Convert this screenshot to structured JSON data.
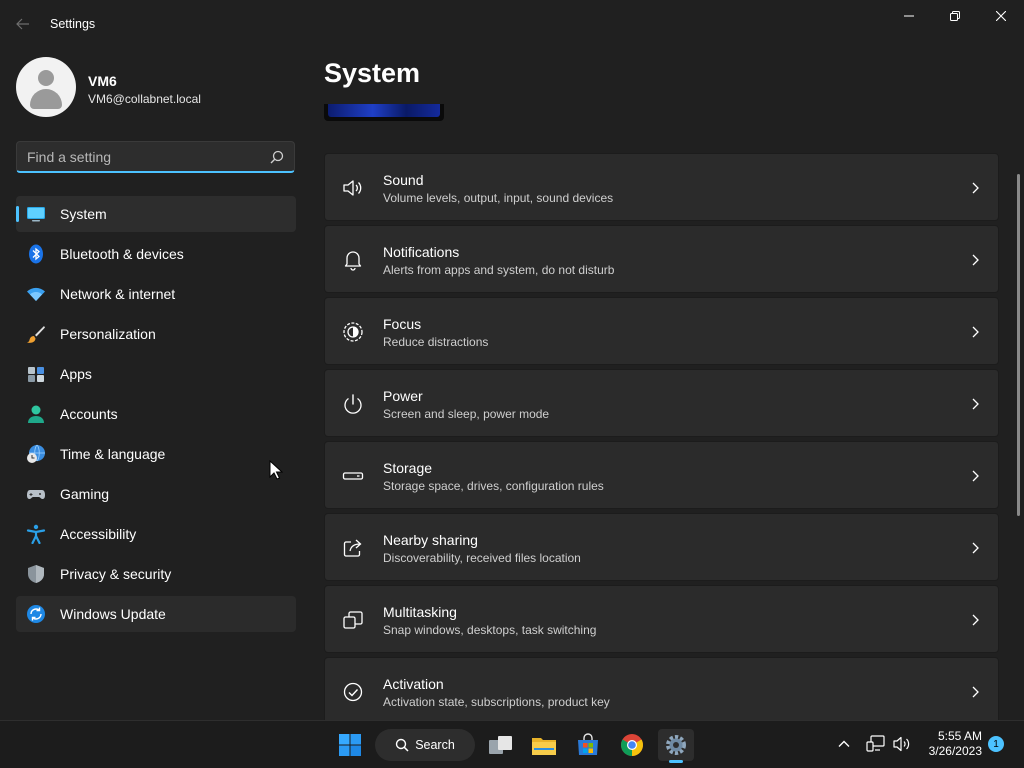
{
  "window": {
    "title": "Settings"
  },
  "user": {
    "name": "VM6",
    "email": "VM6@collabnet.local"
  },
  "search": {
    "placeholder": "Find a setting",
    "value": ""
  },
  "sidebar": {
    "items": [
      {
        "label": "System",
        "icon": "system-icon",
        "selected": true
      },
      {
        "label": "Bluetooth & devices",
        "icon": "bluetooth-icon"
      },
      {
        "label": "Network & internet",
        "icon": "wifi-icon"
      },
      {
        "label": "Personalization",
        "icon": "brush-icon"
      },
      {
        "label": "Apps",
        "icon": "apps-icon"
      },
      {
        "label": "Accounts",
        "icon": "person-icon"
      },
      {
        "label": "Time & language",
        "icon": "globe-clock-icon"
      },
      {
        "label": "Gaming",
        "icon": "gamepad-icon"
      },
      {
        "label": "Accessibility",
        "icon": "accessibility-icon"
      },
      {
        "label": "Privacy & security",
        "icon": "shield-icon"
      },
      {
        "label": "Windows Update",
        "icon": "update-icon",
        "hovered": true
      }
    ]
  },
  "main": {
    "title": "System",
    "cards": [
      {
        "title": "Sound",
        "subtitle": "Volume levels, output, input, sound devices",
        "icon": "speaker-icon"
      },
      {
        "title": "Notifications",
        "subtitle": "Alerts from apps and system, do not disturb",
        "icon": "bell-icon"
      },
      {
        "title": "Focus",
        "subtitle": "Reduce distractions",
        "icon": "focus-icon"
      },
      {
        "title": "Power",
        "subtitle": "Screen and sleep, power mode",
        "icon": "power-icon"
      },
      {
        "title": "Storage",
        "subtitle": "Storage space, drives, configuration rules",
        "icon": "storage-icon"
      },
      {
        "title": "Nearby sharing",
        "subtitle": "Discoverability, received files location",
        "icon": "share-icon"
      },
      {
        "title": "Multitasking",
        "subtitle": "Snap windows, desktops, task switching",
        "icon": "multitasking-icon"
      },
      {
        "title": "Activation",
        "subtitle": "Activation state, subscriptions, product key",
        "icon": "check-circle-icon"
      }
    ]
  },
  "taskbar": {
    "search_label": "Search",
    "time": "5:55 AM",
    "date": "3/26/2023",
    "notification_count": "1"
  },
  "colors": {
    "accent": "#4cc2ff",
    "background": "#202020",
    "card": "#2b2b2b",
    "taskbar": "#1c1c1c"
  }
}
